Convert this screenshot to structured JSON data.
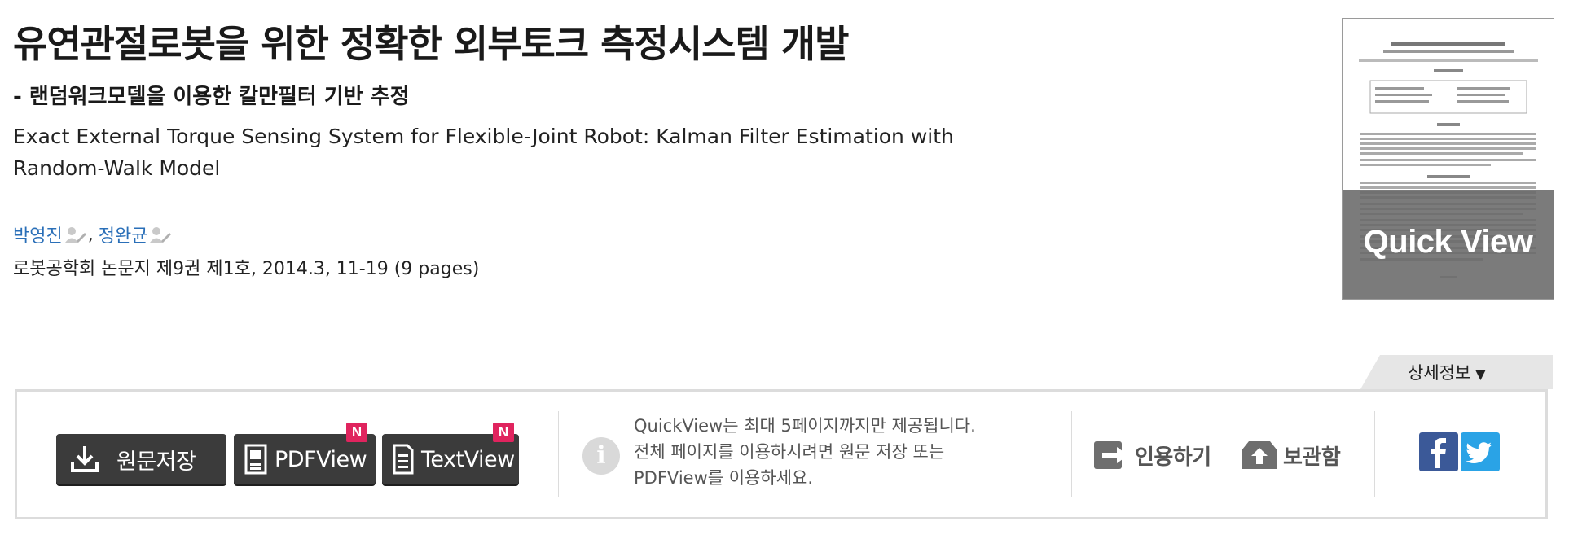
{
  "article": {
    "title_ko": "유연관절로봇을 위한 정확한 외부토크 측정시스템 개발",
    "subtitle_ko": "- 랜덤워크모델을 이용한 칼만필터 기반 추정",
    "title_en": "Exact External Torque Sensing System for Flexible-Joint Robot: Kalman Filter Estimation with Random-Walk Model",
    "authors": [
      {
        "name": "박영진",
        "icon": "author-profile-icon"
      },
      {
        "name": "정완균",
        "icon": "author-profile-icon"
      }
    ],
    "author_separator": ",",
    "journal_info": "로봇공학회 논문지 제9권 제1호, 2014.3, 11-19 (9 pages)"
  },
  "thumbnail": {
    "overlay_label": "Quick View"
  },
  "detail_tab": {
    "label": "상세정보",
    "arrow": "▼"
  },
  "toolbar": {
    "buttons": [
      {
        "label": "원문저장",
        "icon": "download-icon",
        "badge": ""
      },
      {
        "label": "PDFView",
        "icon": "pdf-document-icon",
        "badge": "N"
      },
      {
        "label": "TextView",
        "icon": "text-document-icon",
        "badge": "N"
      }
    ],
    "info_icon": "i",
    "info_lines": [
      "QuickView는 최대 5페이지까지만 제공됩니다.",
      "전체 페이지를 이용하시려면 원문 저장 또는",
      "PDFView를 이용하세요."
    ],
    "actions": [
      {
        "label": "인용하기",
        "icon": "cite-arrow-icon"
      },
      {
        "label": "보관함",
        "icon": "save-archive-icon"
      }
    ],
    "social": [
      {
        "name": "facebook",
        "glyph": "f",
        "color": "#3b5998"
      },
      {
        "name": "twitter",
        "glyph": "twitter-bird",
        "color": "#2aa3e6"
      }
    ]
  }
}
